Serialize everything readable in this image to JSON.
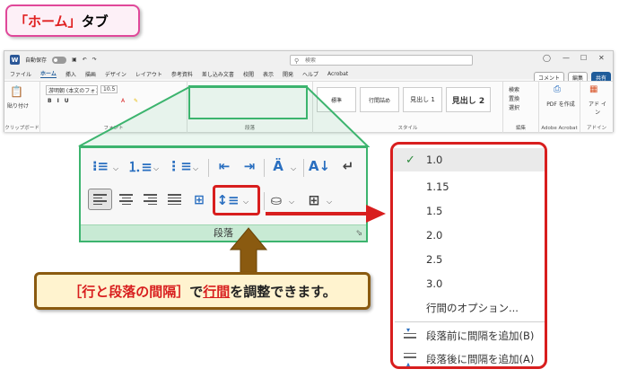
{
  "title_tag": {
    "part1": "「ホーム」",
    "part2": "タブ"
  },
  "ribbon": {
    "autosave": "自動保存",
    "search_placeholder": "検索",
    "menu_tabs": [
      "ファイル",
      "ホーム",
      "挿入",
      "描画",
      "デザイン",
      "レイアウト",
      "参考資料",
      "差し込み文書",
      "校閲",
      "表示",
      "開発",
      "ヘルプ",
      "Acrobat"
    ],
    "comment_btn": "コメント",
    "edit_btn": "編集",
    "share_btn": "共有",
    "paste_label": "貼り付け",
    "clipboard_label": "クリップボード",
    "font_name": "游明朝 (本文のフォント",
    "font_size": "10.5",
    "font_group_label": "フォント",
    "paragraph_group_label": "段落",
    "style_items": [
      "標準",
      "行間詰め",
      "見出し 1",
      "見出し 2"
    ],
    "style_group_label": "スタイル",
    "edit_items": [
      "検索",
      "置換",
      "選択"
    ],
    "edit_group_label": "編集",
    "pdf_label": "PDF を作成",
    "adobe_label": "Adobe Acrobat",
    "addin_label": "アド イン",
    "addin_group_label": "アドイン"
  },
  "paragraph_panel": {
    "footer_label": "段落"
  },
  "line_spacing_menu": {
    "options": [
      "1.0",
      "1.15",
      "1.5",
      "2.0",
      "2.5",
      "3.0"
    ],
    "selected_index": 0,
    "line_options": "行間のオプション...",
    "add_before": "段落前に間隔を追加(B)",
    "add_after": "段落後に間隔を追加(A)"
  },
  "note": {
    "part1": "［行と段落の間隔］",
    "part2": "で",
    "part3": "行間",
    "part4": "を調整できます。"
  },
  "colors": {
    "green": "#3cb46e",
    "red": "#d81e1e",
    "brown": "#8a5a10",
    "pink": "#e0489a"
  }
}
